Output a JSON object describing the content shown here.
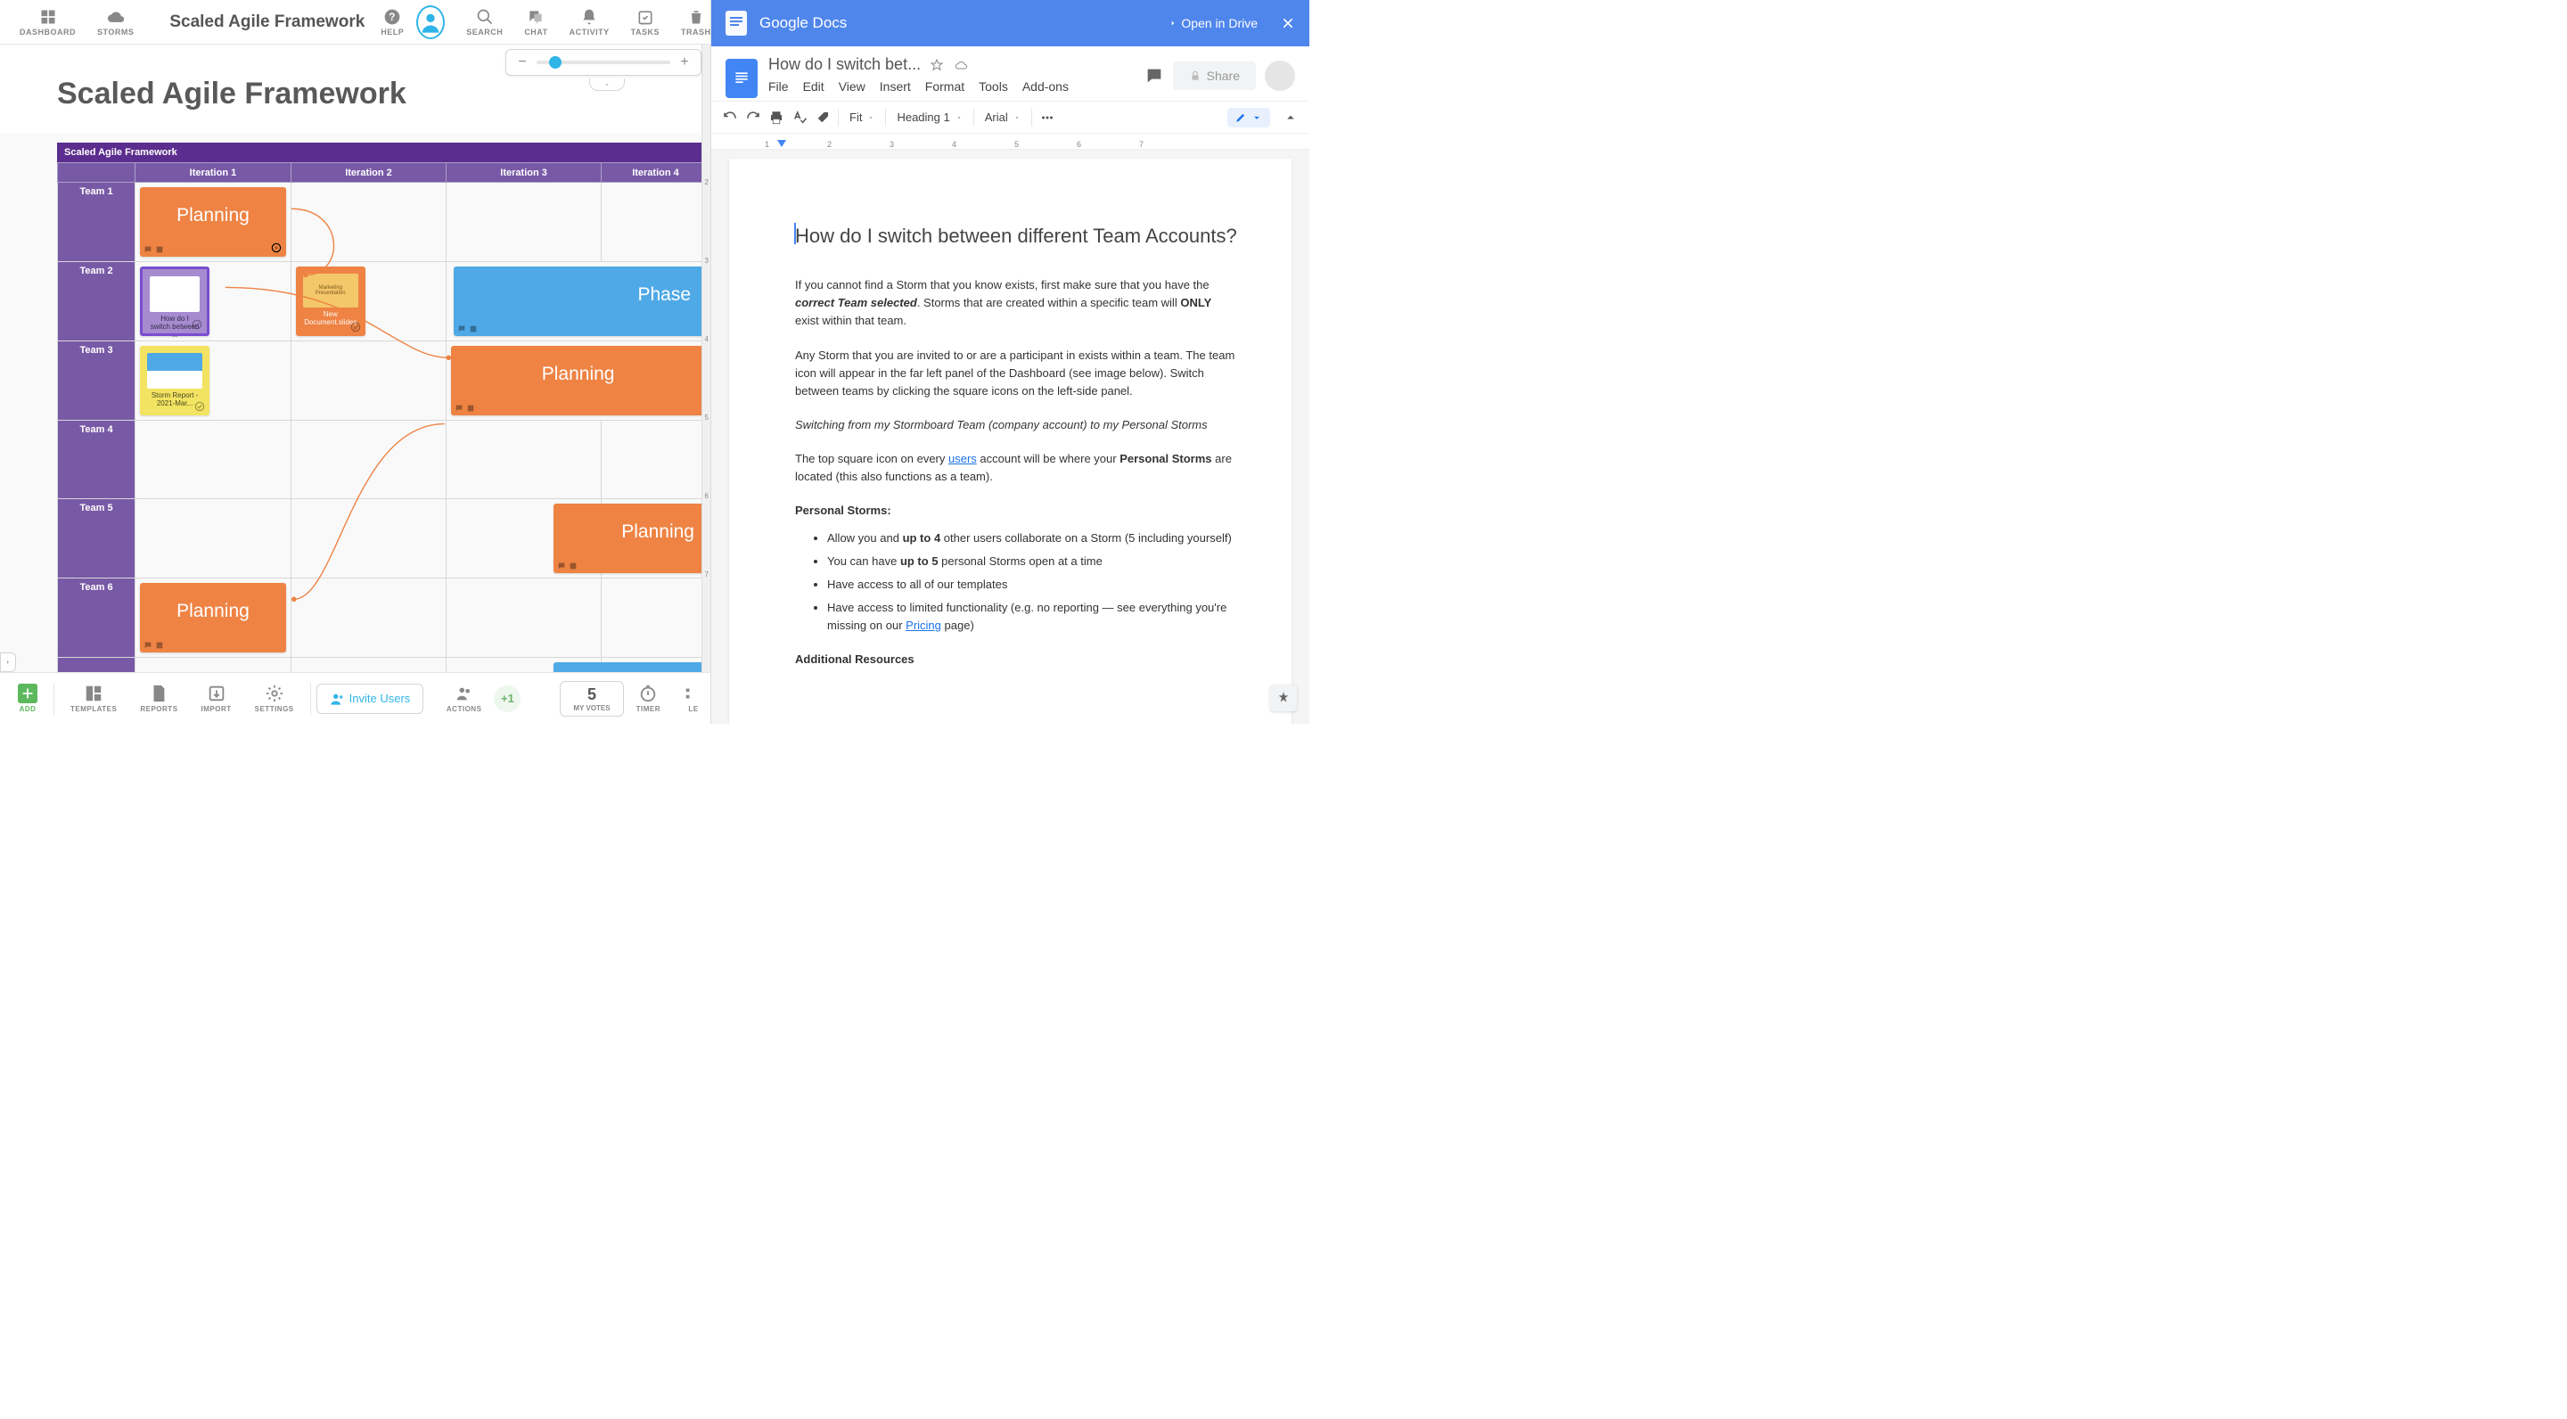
{
  "topnav": {
    "dashboard": "DASHBOARD",
    "storms": "STORMS",
    "title": "Scaled Agile Framework",
    "help": "HELP",
    "search": "SEARCH",
    "chat": "CHAT",
    "activity": "ACTIVITY",
    "tasks": "TASKS",
    "trash": "TRASH"
  },
  "canvas": {
    "title": "Scaled Agile Framework",
    "section": "Scaled Agile Framework",
    "columns": [
      "Iteration 1",
      "Iteration 2",
      "Iteration 3",
      "Iteration 4"
    ],
    "rows": [
      "Team 1",
      "Team 2",
      "Team 3",
      "Team 4",
      "Team 5",
      "Team 6"
    ],
    "cards": {
      "planning": "Planning",
      "phase": "Phase",
      "docCaption": "How do I switch between ...",
      "slidesLine1": "Marketing",
      "slidesLine2": "Presentation",
      "slidesCaption": "New Document.slides",
      "sheetCaption": "Storm Report - 2021-Mar..."
    },
    "rulerMarks": [
      "2",
      "3",
      "4",
      "5",
      "6",
      "7"
    ]
  },
  "bottombar": {
    "add": "ADD",
    "templates": "TEMPLATES",
    "reports": "REPORTS",
    "import": "IMPORT",
    "settings": "SETTINGS",
    "invite": "Invite Users",
    "actions": "ACTIONS",
    "plus1": "+1",
    "votes_num": "5",
    "votes_label": "MY VOTES",
    "timer": "TIMER",
    "legend": "LE"
  },
  "gdocs": {
    "header": "Google Docs",
    "openDrive": "Open in Drive",
    "docTitle": "How do I switch bet...",
    "menus": [
      "File",
      "Edit",
      "View",
      "Insert",
      "Format",
      "Tools",
      "Add-ons"
    ],
    "share": "Share",
    "toolbar": {
      "zoom": "Fit",
      "style": "Heading 1",
      "font": "Arial"
    },
    "ruler": [
      "1",
      "2",
      "3",
      "4",
      "5",
      "6",
      "7"
    ],
    "body": {
      "h1": "How do I switch between different Team Accounts?",
      "p1a": "If you cannot find a Storm that you know exists, first make sure that you have the ",
      "p1b": "correct Team selected",
      "p1c": ". Storms that are created within a specific team will ",
      "p1d": "ONLY",
      "p1e": " exist within that team.",
      "p2": "Any Storm that you are invited to or are a participant in exists within a team. The team icon will appear in the far left panel of the Dashboard (see image below). Switch between teams by clicking the square icons on the left-side panel.",
      "p3": "Switching from my Stormboard Team (company account) to my Personal Storms",
      "p4a": "The top square icon on every ",
      "p4b": "users",
      "p4c": " account will be where your ",
      "p4d": "Personal Storms",
      "p4e": " are located (this also functions as a team).",
      "h2": "Personal Storms:",
      "li1a": "Allow you and ",
      "li1b": "up to 4",
      "li1c": " other users collaborate on a Storm (5 including yourself)",
      "li2a": "You can have ",
      "li2b": "up to 5",
      "li2c": " personal Storms open at a time",
      "li3": "Have access to all of our templates",
      "li4a": "Have access to limited functionality (e.g. no reporting — see everything you're missing on our ",
      "li4b": "Pricing",
      "li4c": " page)",
      "h3": "Additional Resources"
    }
  }
}
